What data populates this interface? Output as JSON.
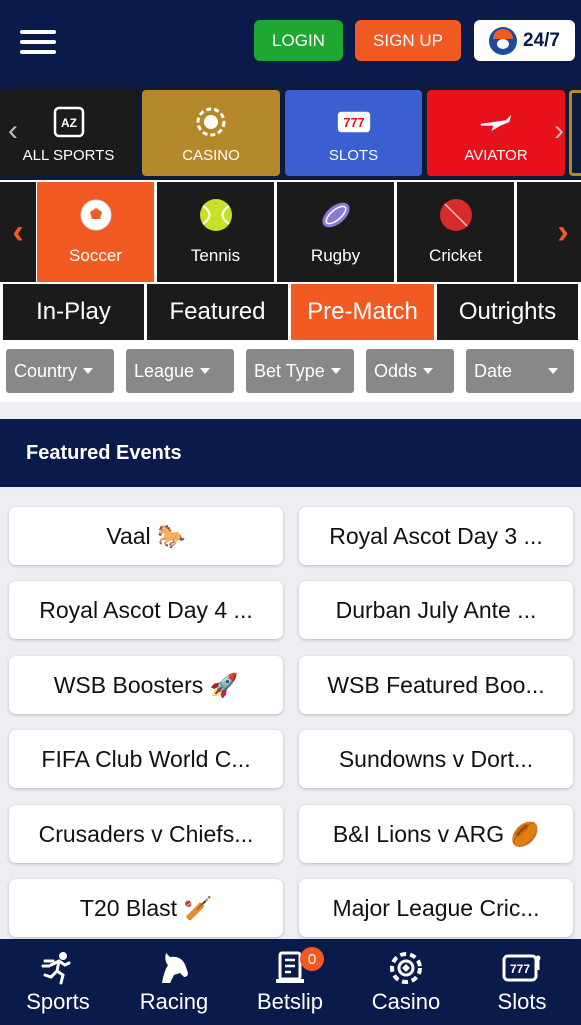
{
  "header": {
    "login_label": "LOGIN",
    "signup_label": "SIGN UP",
    "support_label": "24/7"
  },
  "categories": [
    {
      "label": "ALL SPORTS",
      "icon": "az-icon",
      "color": "#1b1b1b"
    },
    {
      "label": "CASINO",
      "icon": "chip-icon",
      "color": "#b5892a"
    },
    {
      "label": "SLOTS",
      "icon": "slots-777-icon",
      "color": "#3a5fd0"
    },
    {
      "label": "AVIATOR",
      "icon": "plane-icon",
      "color": "#e8101a"
    }
  ],
  "sports": [
    {
      "label": "Soccer",
      "icon": "soccer-ball-icon",
      "active": true
    },
    {
      "label": "Tennis",
      "icon": "tennis-ball-icon",
      "active": false
    },
    {
      "label": "Rugby",
      "icon": "rugby-ball-icon",
      "active": false
    },
    {
      "label": "Cricket",
      "icon": "cricket-ball-icon",
      "active": false
    }
  ],
  "tabs": [
    {
      "label": "In-Play",
      "active": false
    },
    {
      "label": "Featured",
      "active": false
    },
    {
      "label": "Pre-Match",
      "active": true
    },
    {
      "label": "Outrights",
      "active": false
    }
  ],
  "filters": [
    {
      "label": "Country"
    },
    {
      "label": "League"
    },
    {
      "label": "Bet Type"
    },
    {
      "label": "Odds"
    },
    {
      "label": "Date"
    }
  ],
  "featured": {
    "title": "Featured Events",
    "events": [
      {
        "label": "Vaal 🐎"
      },
      {
        "label": "Royal Ascot Day 3 ..."
      },
      {
        "label": "Royal Ascot Day 4 ..."
      },
      {
        "label": "Durban July Ante ..."
      },
      {
        "label": "WSB Boosters 🚀"
      },
      {
        "label": "WSB Featured Boo..."
      },
      {
        "label": "FIFA Club World C..."
      },
      {
        "label": "Sundowns v Dort..."
      },
      {
        "label": "Crusaders v Chiefs..."
      },
      {
        "label": "B&I Lions v ARG 🏉"
      },
      {
        "label": "T20 Blast 🏏"
      },
      {
        "label": "Major League Cric..."
      }
    ]
  },
  "bottom_nav": [
    {
      "label": "Sports",
      "icon": "runner-icon"
    },
    {
      "label": "Racing",
      "icon": "horse-head-icon"
    },
    {
      "label": "Betslip",
      "icon": "betslip-icon",
      "badge": "0"
    },
    {
      "label": "Casino",
      "icon": "chip-icon"
    },
    {
      "label": "Slots",
      "icon": "slots-777-icon"
    }
  ],
  "colors": {
    "navy": "#0a1a4a",
    "orange": "#f15a22",
    "green": "#1ea832"
  }
}
